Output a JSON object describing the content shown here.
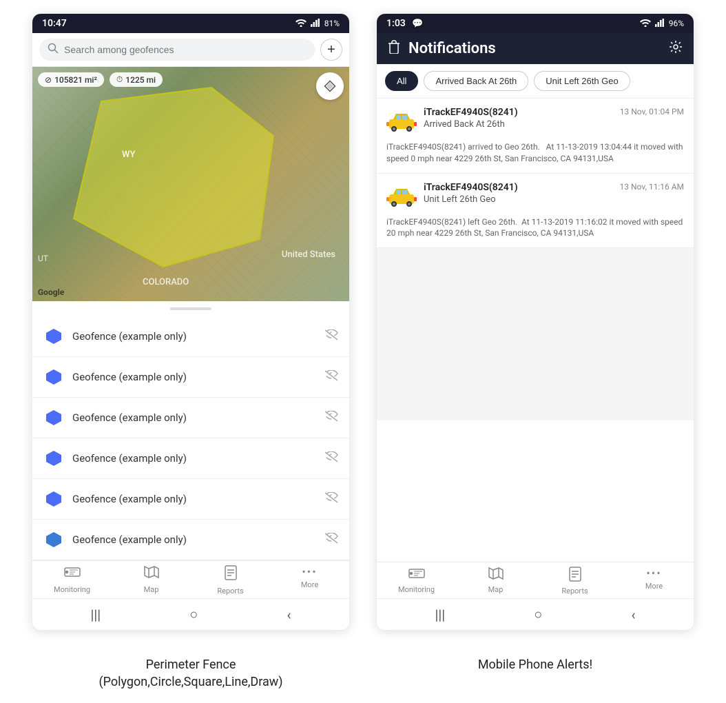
{
  "left_phone": {
    "status_bar": {
      "time": "10:47",
      "signal": "WiFi",
      "battery": "81%"
    },
    "search": {
      "placeholder": "Search among geofences"
    },
    "map": {
      "stat1_icon": "⊘",
      "stat1_value": "105821 mi²",
      "stat2_icon": "⏱",
      "stat2_value": "1225 mi",
      "label_wy": "WY",
      "label_us": "United States",
      "label_co": "COLORADO",
      "label_ut": "UT"
    },
    "geofences": [
      {
        "label": "Geofence (example only)"
      },
      {
        "label": "Geofence (example only)"
      },
      {
        "label": "Geofence (example only)"
      },
      {
        "label": "Geofence (example only)"
      },
      {
        "label": "Geofence (example only)"
      },
      {
        "label": "Geofence (example only)"
      }
    ],
    "bottom_nav": [
      {
        "icon": "🚌",
        "label": "Monitoring"
      },
      {
        "icon": "🗺",
        "label": "Map"
      },
      {
        "icon": "📊",
        "label": "Reports"
      },
      {
        "icon": "•••",
        "label": "More"
      }
    ],
    "android_nav": [
      "|||",
      "○",
      "<"
    ]
  },
  "right_phone": {
    "status_bar": {
      "time": "1:03",
      "battery": "96%"
    },
    "header": {
      "title": "Notifications",
      "delete_icon": "🗑",
      "settings_icon": "⚙"
    },
    "filter_tabs": [
      {
        "label": "All",
        "active": true
      },
      {
        "label": "Arrived Back At 26th",
        "active": false
      },
      {
        "label": "Unit Left 26th Geo",
        "active": false
      }
    ],
    "notifications": [
      {
        "device": "iTrackEF4940S(8241)",
        "time": "13 Nov, 01:04 PM",
        "event": "Arrived Back At 26th",
        "description": "iTrackEF4940S(8241) arrived to Geo 26th.   At 11-13-2019 13:04:44 it moved with speed 0 mph near 4229 26th St, San Francisco, CA 94131,USA"
      },
      {
        "device": "iTrackEF4940S(8241)",
        "time": "13 Nov, 11:16 AM",
        "event": "Unit Left 26th Geo",
        "description": "iTrackEF4940S(8241) left Geo 26th.  At 11-13-2019 11:16:02 it moved with speed 20 mph near 4229 26th St, San Francisco, CA 94131,USA"
      }
    ],
    "bottom_nav": [
      {
        "icon": "🚌",
        "label": "Monitoring"
      },
      {
        "icon": "🗺",
        "label": "Map"
      },
      {
        "icon": "📊",
        "label": "Reports"
      },
      {
        "icon": "•••",
        "label": "More"
      }
    ],
    "android_nav": [
      "|||",
      "○",
      "<"
    ]
  },
  "captions": {
    "left": "Perimeter Fence\n(Polygon,Circle,Square,Line,Draw)",
    "right": "Mobile Phone Alerts!"
  }
}
